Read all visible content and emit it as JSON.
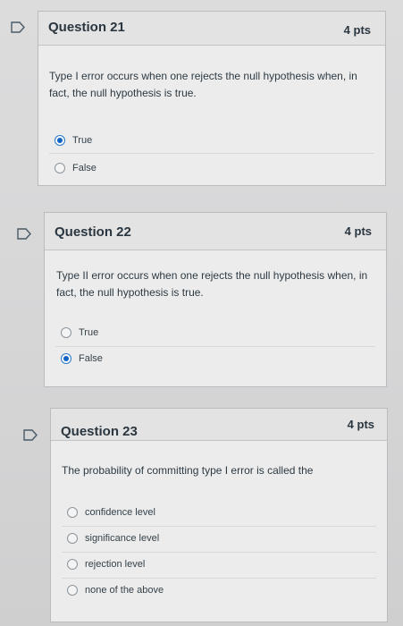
{
  "questions": [
    {
      "title": "Question 21",
      "points": "4 pts",
      "text": "Type I error occurs when one rejects the null hypothesis when, in fact, the null hypothesis is true.",
      "answers": [
        {
          "label": "True",
          "selected": true
        },
        {
          "label": "False",
          "selected": false
        }
      ]
    },
    {
      "title": "Question 22",
      "points": "4 pts",
      "text": "Type II error occurs when one rejects the null hypothesis when, in fact, the null hypothesis is true.",
      "answers": [
        {
          "label": "True",
          "selected": false
        },
        {
          "label": "False",
          "selected": true
        }
      ]
    },
    {
      "title": "Question 23",
      "points": "4 pts",
      "text": "The probability of committing type I error is called the",
      "answers": [
        {
          "label": "confidence level",
          "selected": false
        },
        {
          "label": "significance level",
          "selected": false
        },
        {
          "label": "rejection level",
          "selected": false
        },
        {
          "label": "none of the above",
          "selected": false
        }
      ]
    }
  ],
  "colors": {
    "accent": "#0e63c4",
    "border": "#b9bcbf",
    "text": "#2d3b45"
  }
}
